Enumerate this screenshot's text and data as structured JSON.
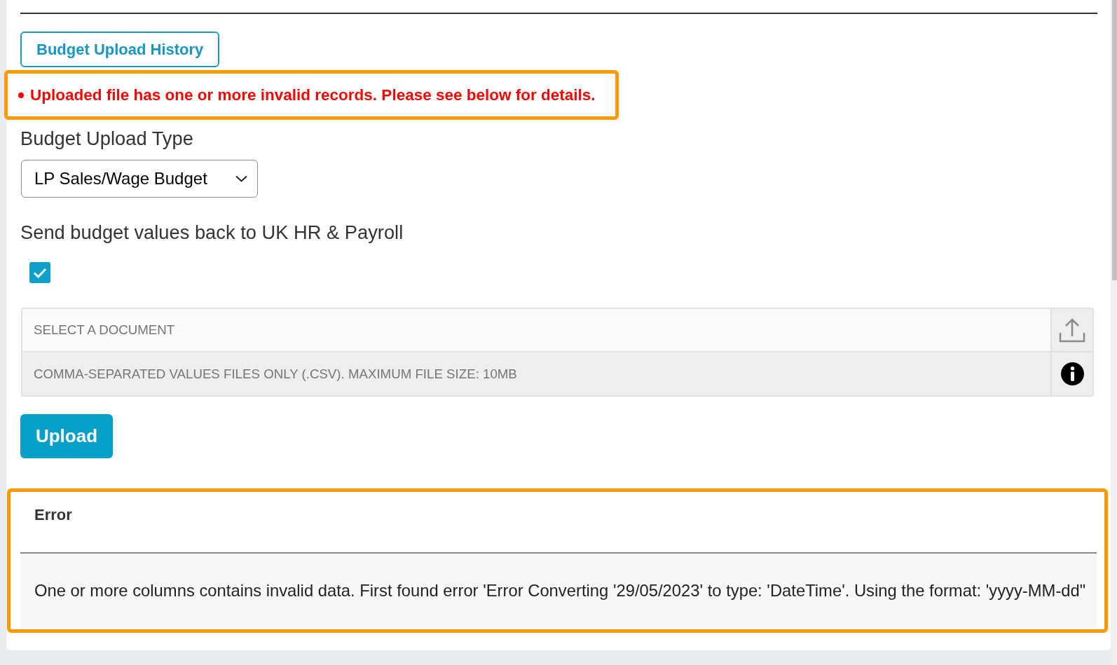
{
  "history_button": {
    "label": "Budget Upload History"
  },
  "alert": {
    "highlighted": true,
    "messages": [
      "Uploaded file has one or more invalid records. Please see below for details."
    ]
  },
  "upload_type": {
    "label": "Budget Upload Type",
    "value": "LP Sales/Wage Budget"
  },
  "send_back": {
    "label": "Send budget values back to UK HR & Payroll",
    "checked": true
  },
  "document_picker": {
    "placeholder": "SELECT A DOCUMENT",
    "hint": "COMMA-SEPARATED VALUES FILES ONLY (.CSV). MAXIMUM FILE SIZE: 10MB"
  },
  "upload_button": {
    "label": "Upload"
  },
  "error_table": {
    "highlighted": true,
    "columns": [
      "Error"
    ],
    "rows": [
      [
        "One or more columns contains invalid data. First found error 'Error Converting '29/05/2023' to type: 'DateTime'. Using the format: 'yyyy-MM-dd\""
      ]
    ]
  }
}
